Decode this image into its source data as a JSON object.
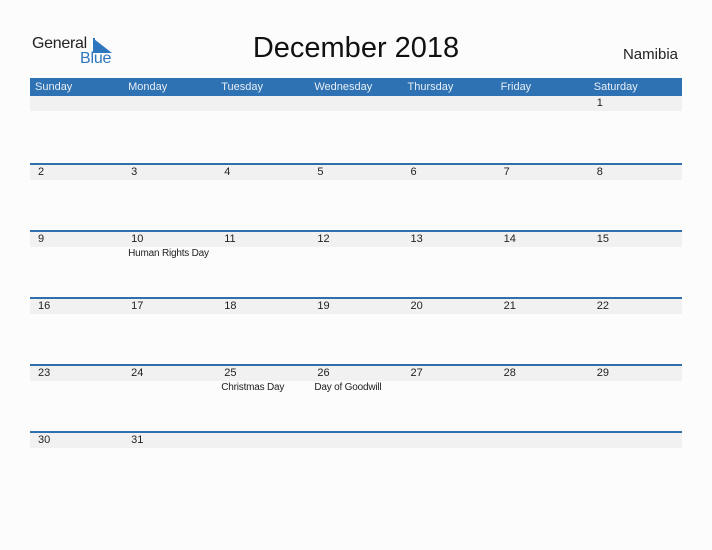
{
  "logo": {
    "line1": "General",
    "line2": "Blue",
    "brand_color": "#2e76bd"
  },
  "header": {
    "title": "December 2018",
    "country": "Namibia"
  },
  "calendar": {
    "header_color": "#2e72b3",
    "weekdays": [
      "Sunday",
      "Monday",
      "Tuesday",
      "Wednesday",
      "Thursday",
      "Friday",
      "Saturday"
    ],
    "weeks": [
      [
        {
          "day": "",
          "event": ""
        },
        {
          "day": "",
          "event": ""
        },
        {
          "day": "",
          "event": ""
        },
        {
          "day": "",
          "event": ""
        },
        {
          "day": "",
          "event": ""
        },
        {
          "day": "",
          "event": ""
        },
        {
          "day": "1",
          "event": ""
        }
      ],
      [
        {
          "day": "2",
          "event": ""
        },
        {
          "day": "3",
          "event": ""
        },
        {
          "day": "4",
          "event": ""
        },
        {
          "day": "5",
          "event": ""
        },
        {
          "day": "6",
          "event": ""
        },
        {
          "day": "7",
          "event": ""
        },
        {
          "day": "8",
          "event": ""
        }
      ],
      [
        {
          "day": "9",
          "event": ""
        },
        {
          "day": "10",
          "event": "Human Rights Day"
        },
        {
          "day": "11",
          "event": ""
        },
        {
          "day": "12",
          "event": ""
        },
        {
          "day": "13",
          "event": ""
        },
        {
          "day": "14",
          "event": ""
        },
        {
          "day": "15",
          "event": ""
        }
      ],
      [
        {
          "day": "16",
          "event": ""
        },
        {
          "day": "17",
          "event": ""
        },
        {
          "day": "18",
          "event": ""
        },
        {
          "day": "19",
          "event": ""
        },
        {
          "day": "20",
          "event": ""
        },
        {
          "day": "21",
          "event": ""
        },
        {
          "day": "22",
          "event": ""
        }
      ],
      [
        {
          "day": "23",
          "event": ""
        },
        {
          "day": "24",
          "event": ""
        },
        {
          "day": "25",
          "event": "Christmas Day"
        },
        {
          "day": "26",
          "event": "Day of Goodwill"
        },
        {
          "day": "27",
          "event": ""
        },
        {
          "day": "28",
          "event": ""
        },
        {
          "day": "29",
          "event": ""
        }
      ],
      [
        {
          "day": "30",
          "event": ""
        },
        {
          "day": "31",
          "event": ""
        },
        {
          "day": "",
          "event": ""
        },
        {
          "day": "",
          "event": ""
        },
        {
          "day": "",
          "event": ""
        },
        {
          "day": "",
          "event": ""
        },
        {
          "day": "",
          "event": ""
        }
      ]
    ]
  }
}
